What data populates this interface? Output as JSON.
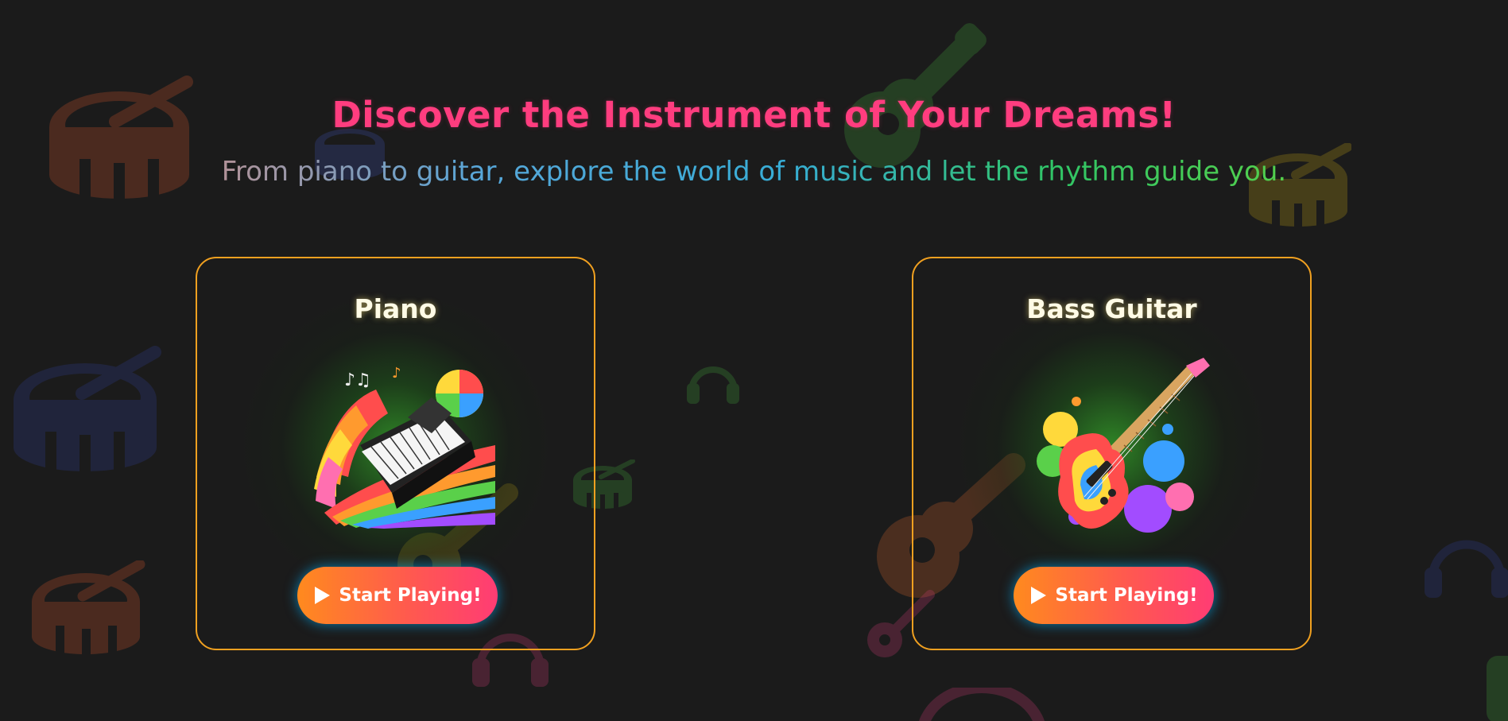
{
  "header": {
    "title": "Discover the Instrument of Your Dreams!",
    "subtitle": "From piano to guitar, explore the world of music and let the rhythm guide you."
  },
  "cards": [
    {
      "title": "Piano",
      "button_label": "Start Playing!",
      "art_icon": "piano-keyboard-rainbow"
    },
    {
      "title": "Bass Guitar",
      "button_label": "Start Playing!",
      "art_icon": "bass-guitar-rainbow"
    }
  ],
  "colors": {
    "background": "#1b1b1b",
    "title": "#ff3d7f",
    "card_border": "#f0a020",
    "button_gradient_start": "#ff8a1e",
    "button_gradient_end": "#ff3c74",
    "button_glow": "#00b4ff"
  },
  "background_icons": [
    "drum-icon",
    "guitar-icon",
    "headphones-icon"
  ]
}
